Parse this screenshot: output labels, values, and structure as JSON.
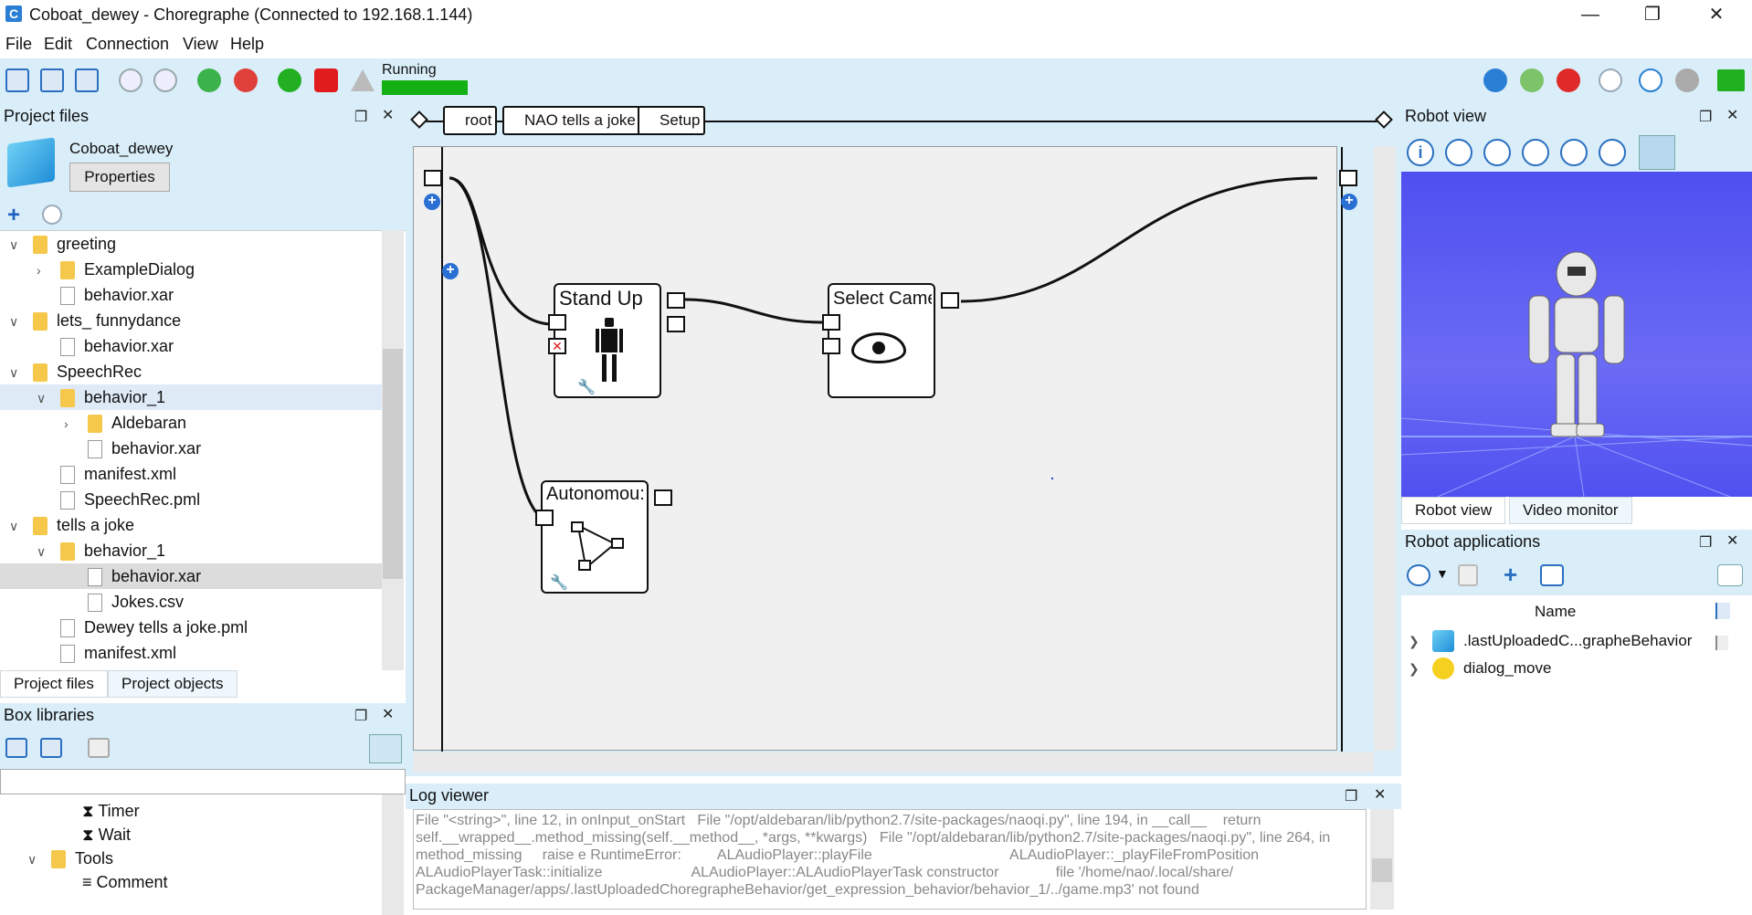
{
  "window": {
    "title": "Coboat_dewey - Choregraphe (Connected to 192.168.1.144)",
    "app_icon": "C"
  },
  "menu": [
    "File",
    "Edit",
    "Connection",
    "View",
    "Help"
  ],
  "toolbar": {
    "status": "Running",
    "progress": 1.0
  },
  "project_files": {
    "title": "Project files",
    "project_name": "Coboat_dewey",
    "properties_label": "Properties",
    "tree": [
      {
        "label": "greeting",
        "type": "folder",
        "depth": 0,
        "expanded": true
      },
      {
        "label": "ExampleDialog",
        "type": "folder",
        "depth": 1,
        "expanded": false
      },
      {
        "label": "behavior.xar",
        "type": "file",
        "depth": 1
      },
      {
        "label": "lets_ funnydance",
        "type": "folder",
        "depth": 0,
        "expanded": true
      },
      {
        "label": "behavior.xar",
        "type": "file",
        "depth": 1
      },
      {
        "label": "SpeechRec",
        "type": "folder",
        "depth": 0,
        "expanded": true
      },
      {
        "label": "behavior_1",
        "type": "folder",
        "depth": 1,
        "expanded": true
      },
      {
        "label": "Aldebaran",
        "type": "folder",
        "depth": 2,
        "expanded": false
      },
      {
        "label": "behavior.xar",
        "type": "file",
        "depth": 2
      },
      {
        "label": "manifest.xml",
        "type": "file",
        "depth": 1
      },
      {
        "label": "SpeechRec.pml",
        "type": "file",
        "depth": 1
      },
      {
        "label": "tells a joke",
        "type": "folder",
        "depth": 0,
        "expanded": true
      },
      {
        "label": "behavior_1",
        "type": "folder",
        "depth": 1,
        "expanded": true
      },
      {
        "label": "behavior.xar",
        "type": "file",
        "depth": 2,
        "selected": true
      },
      {
        "label": "Jokes.csv",
        "type": "file",
        "depth": 2
      },
      {
        "label": "Dewey tells a joke.pml",
        "type": "file",
        "depth": 1
      },
      {
        "label": "manifest.xml",
        "type": "file",
        "depth": 1
      }
    ],
    "tabs": [
      "Project files",
      "Project objects"
    ]
  },
  "box_libraries": {
    "title": "Box libraries",
    "items": [
      {
        "label": "Timer",
        "depth": 2
      },
      {
        "label": "Wait",
        "depth": 2
      },
      {
        "label": "Tools",
        "depth": 1,
        "folder": true
      },
      {
        "label": "Comment",
        "depth": 2
      }
    ]
  },
  "breadcrumb": [
    "root",
    "NAO tells a joke",
    "Setup"
  ],
  "flow": {
    "boxes": [
      {
        "title": "Stand Up"
      },
      {
        "title": "Select Came"
      },
      {
        "title": "Autonomou:"
      }
    ]
  },
  "log_viewer": {
    "title": "Log viewer",
    "lines": [
      "File \"<string>\", line 12, in onInput_onStart   File \"/opt/aldebaran/lib/python2.7/site-packages/naoqi.py\", line 194, in __call__    return",
      "self.__wrapped__.method_missing(self.__method__, *args, **kwargs)   File \"/opt/aldebaran/lib/python2.7/site-packages/naoqi.py\", line 264, in",
      "method_missing     raise e RuntimeError:         ALAudioPlayer::playFile                                  ALAudioPlayer::_playFileFromPosition",
      "ALAudioPlayerTask::initialize                      ALAudioPlayer::ALAudioPlayerTask constructor              file '/home/nao/.local/share/",
      "PackageManager/apps/.lastUploadedChoregrapheBehavior/get_expression_behavior/behavior_1/../game.mp3' not found"
    ]
  },
  "robot_view": {
    "title": "Robot view",
    "tabs": [
      "Robot view",
      "Video monitor"
    ]
  },
  "robot_apps": {
    "title": "Robot applications",
    "column": "Name",
    "items": [
      ".lastUploadedC...grapheBehavior",
      "dialog_move"
    ]
  },
  "colors": {
    "panel": "#d9eef9",
    "accent": "#2a7fd4",
    "running": "#14b014",
    "robot_bg": "#5a5cf0"
  }
}
